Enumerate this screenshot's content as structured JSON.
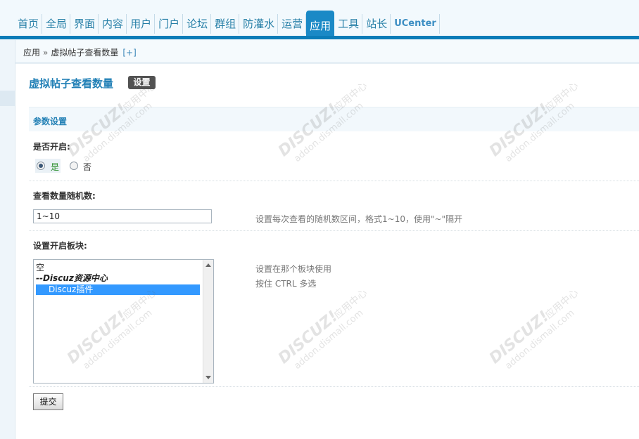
{
  "nav": {
    "items": [
      "首页",
      "全局",
      "界面",
      "内容",
      "用户",
      "门户",
      "论坛",
      "群组",
      "防灌水",
      "运营",
      "应用",
      "工具",
      "站长",
      "UCenter"
    ],
    "active": "应用"
  },
  "breadcrumb": {
    "parent": "应用",
    "separator": "»",
    "current": "虚拟帖子查看数量",
    "add": "[+]"
  },
  "page": {
    "title": "虚拟帖子查看数量",
    "settings_button": "设置"
  },
  "section": {
    "title": "参数设置"
  },
  "fields": {
    "enable": {
      "label": "是否开启:",
      "option_yes": "是",
      "option_no": "否",
      "selected": "是"
    },
    "random": {
      "label": "查看数量随机数:",
      "value": "1~10",
      "hint": "设置每次查看的随机数区间，格式1~10，使用\"~\"隔开"
    },
    "forums": {
      "label": "设置开启板块:",
      "options": [
        "空",
        "--Discuz资源中心",
        "Discuz插件"
      ],
      "selected": "Discuz插件",
      "hint_line1": "设置在那个板块使用",
      "hint_line2": "按住 CTRL 多选"
    }
  },
  "submit_label": "提交",
  "watermark": {
    "brand": "DISCUZ!",
    "text1": "应用中心",
    "text2": "贰道",
    "url": "addon.dismall.com"
  }
}
